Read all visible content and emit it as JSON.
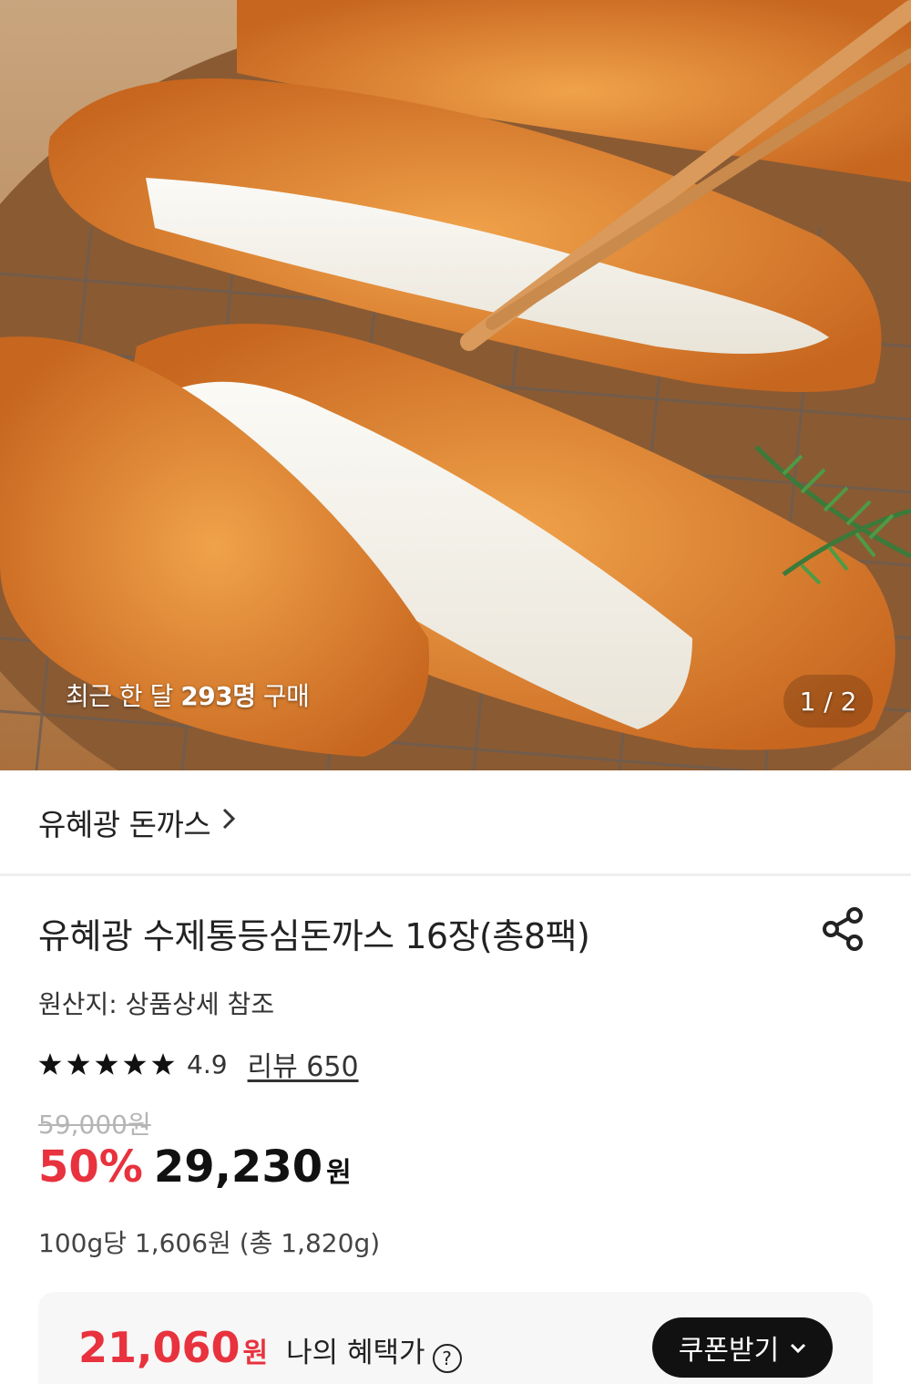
{
  "hero": {
    "caption_prefix": "최근 한 달 ",
    "caption_count": "293명",
    "caption_suffix": " 구매",
    "pager": "1 / 2"
  },
  "brand": {
    "name": "유혜광 돈까스",
    "chevron_icon": "chevron-right-icon"
  },
  "product": {
    "title": "유혜광 수제통등심돈까스 16장(총8팩)",
    "origin": "원산지: 상품상세 참조",
    "share_icon": "share-icon",
    "rating": {
      "stars": 5,
      "value": "4.9",
      "review_label": "리뷰 650"
    },
    "original_price": "59,000원",
    "discount": "50%",
    "price": "29,230",
    "currency": "원",
    "unit_price": "100g당 1,606원 (총 1,820g)"
  },
  "benefit": {
    "amount": "21,060",
    "currency": "원",
    "label": "나의 혜택가",
    "help_icon": "question-circle-icon",
    "help_glyph": "?",
    "coupon_button": "쿠폰받기",
    "coupon_caret": "∨"
  },
  "colors": {
    "accent_red": "#e8323e",
    "button_black": "#111111",
    "benefit_bg": "#f7f7f7"
  }
}
